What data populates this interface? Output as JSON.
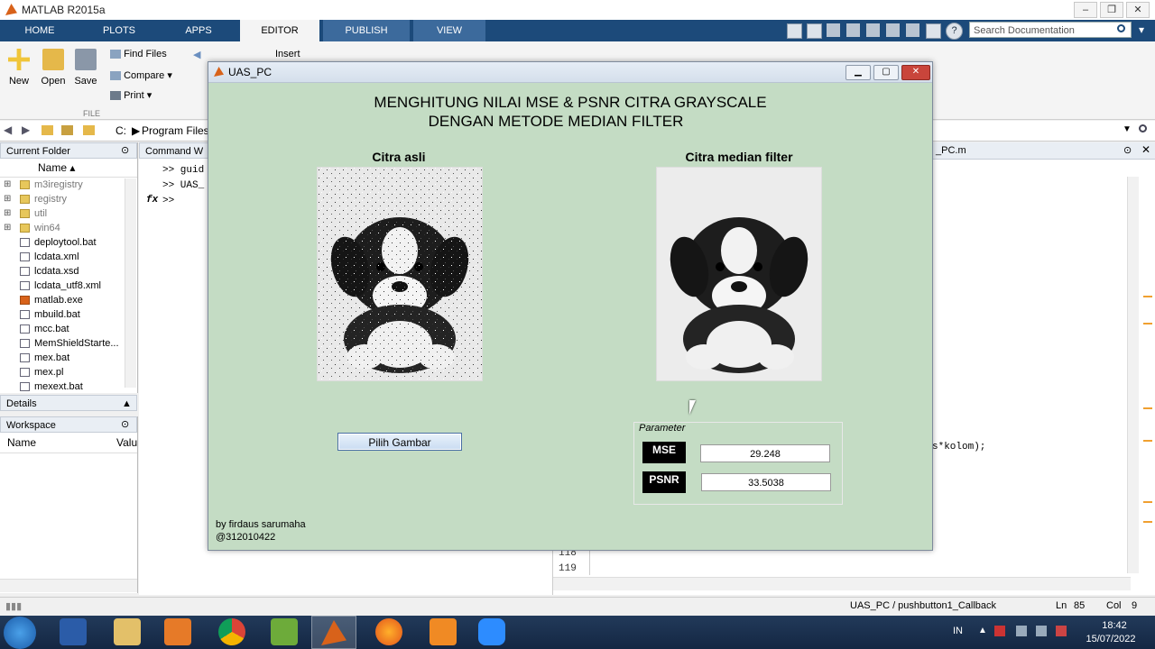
{
  "window": {
    "title": "MATLAB R2015a"
  },
  "tabs": [
    "HOME",
    "PLOTS",
    "APPS",
    "EDITOR",
    "PUBLISH",
    "VIEW"
  ],
  "active_tab": "EDITOR",
  "search": {
    "placeholder": "Search Documentation"
  },
  "ribbon": {
    "new": "New",
    "open": "Open",
    "save": "Save",
    "find_files": "Find Files",
    "compare": "Compare",
    "print": "Print",
    "insert": "Insert",
    "file_group": "FILE"
  },
  "address": {
    "root": "C:",
    "folder": "Program Files"
  },
  "current_folder": {
    "title": "Current Folder",
    "col_name": "Name",
    "items": [
      {
        "name": "m3iregistry",
        "type": "folder"
      },
      {
        "name": "registry",
        "type": "folder"
      },
      {
        "name": "util",
        "type": "folder"
      },
      {
        "name": "win64",
        "type": "folder"
      },
      {
        "name": "deploytool.bat",
        "type": "file"
      },
      {
        "name": "lcdata.xml",
        "type": "file"
      },
      {
        "name": "lcdata.xsd",
        "type": "file"
      },
      {
        "name": "lcdata_utf8.xml",
        "type": "file"
      },
      {
        "name": "matlab.exe",
        "type": "matlab"
      },
      {
        "name": "mbuild.bat",
        "type": "file"
      },
      {
        "name": "mcc.bat",
        "type": "file"
      },
      {
        "name": "MemShieldStarte...",
        "type": "file"
      },
      {
        "name": "mex.bat",
        "type": "file"
      },
      {
        "name": "mex.pl",
        "type": "file"
      },
      {
        "name": "mexext.bat",
        "type": "file"
      }
    ]
  },
  "details": {
    "title": "Details"
  },
  "workspace": {
    "title": "Workspace",
    "col_name": "Name",
    "col_value": "Valu"
  },
  "command_window": {
    "title": "Command W",
    "lines": [
      ">> guid",
      ">> UAS_",
      ">>"
    ],
    "fx": "fx"
  },
  "editor": {
    "tab": "_PC.m",
    "code_snippet": "s*kolom);",
    "line_numbers": [
      "118",
      "119"
    ]
  },
  "dialog": {
    "title": "UAS_PC",
    "heading_line1": "MENGHITUNG NILAI MSE & PSNR CITRA GRAYSCALE",
    "heading_line2": "DENGAN METODE MEDIAN FILTER",
    "label_original": "Citra asli",
    "label_filtered": "Citra median filter",
    "button_pilih": "Pilih Gambar",
    "param_title": "Parameter",
    "mse_label": "MSE",
    "mse_value": "29.248",
    "psnr_label": "PSNR",
    "psnr_value": "33.5038",
    "author_line1": "by firdaus sarumaha",
    "author_line2": "@312010422"
  },
  "statusbar": {
    "callback": "UAS_PC / pushbutton1_Callback",
    "ln_label": "Ln",
    "ln": "85",
    "col_label": "Col",
    "col": "9"
  },
  "taskbar": {
    "lang": "IN",
    "time": "18:42",
    "date": "15/07/2022"
  }
}
